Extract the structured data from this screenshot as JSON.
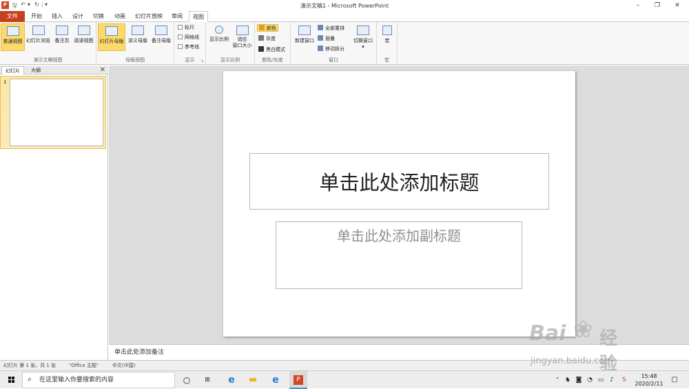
{
  "window": {
    "title": "演示文稿1 - Microsoft PowerPoint",
    "app_icon": "P",
    "qat": [
      "save-icon",
      "undo-icon",
      "redo-icon",
      "customize-icon"
    ],
    "controls": {
      "minimize": "–",
      "maximize": "❐",
      "close": "✕"
    }
  },
  "tabs": [
    {
      "label": "文件"
    },
    {
      "label": "开始"
    },
    {
      "label": "插入"
    },
    {
      "label": "设计"
    },
    {
      "label": "切换"
    },
    {
      "label": "动画"
    },
    {
      "label": "幻灯片放映"
    },
    {
      "label": "审阅"
    },
    {
      "label": "视图"
    }
  ],
  "ribbon": {
    "groups": [
      {
        "label": "演示文稿视图",
        "buttons": [
          "普通视图",
          "幻灯片浏览",
          "备注页",
          "阅读视图"
        ]
      },
      {
        "label": "母版视图",
        "buttons": [
          "幻灯片母版",
          "讲义母版",
          "备注母版"
        ]
      },
      {
        "label": "显示",
        "checks": [
          "标尺",
          "网格线",
          "参考线"
        ]
      },
      {
        "label": "显示比例",
        "buttons": [
          "显示比例",
          "适应",
          "窗口大小"
        ]
      },
      {
        "label": "颜色/灰度",
        "items": [
          "颜色",
          "灰度",
          "黑白模式"
        ]
      },
      {
        "label": "窗口",
        "buttons": [
          "新建窗口"
        ],
        "items": [
          "全部重排",
          "层叠",
          "移动拆分"
        ],
        "switch": "切换窗口"
      },
      {
        "label": "宏",
        "buttons": [
          "宏"
        ]
      }
    ]
  },
  "left_panel": {
    "tabs": [
      "幻灯片",
      "大纲"
    ],
    "close": "✕",
    "slide_number": "1"
  },
  "slide": {
    "title_placeholder": "单击此处添加标题",
    "subtitle_placeholder": "单击此处添加副标题"
  },
  "notes_placeholder": "单击此处添加备注",
  "status": {
    "slide_info": "幻灯片 第 1 张，共 1 张",
    "theme": "\"Office 主题\"",
    "language": "中文(中国)"
  },
  "taskbar": {
    "search_placeholder": "在这里输入你要搜索的内容",
    "time": "15:48",
    "date": "2020/2/11"
  },
  "watermark": {
    "brand": "Bai",
    "brand2": "经验",
    "url": "jingyan.baidu.com"
  }
}
